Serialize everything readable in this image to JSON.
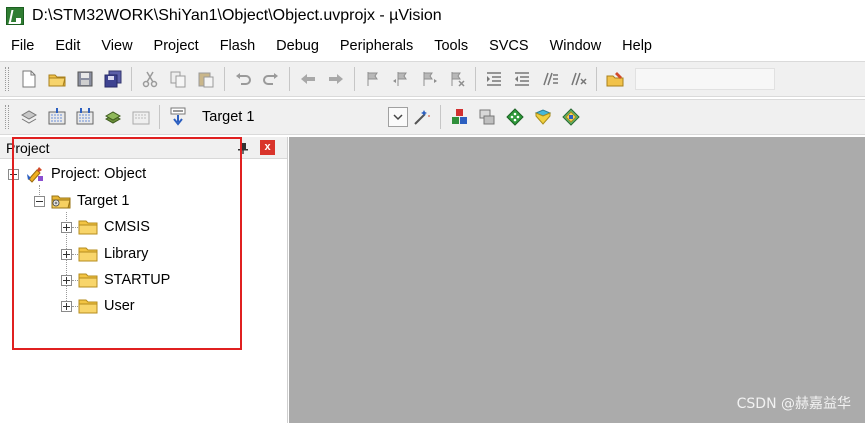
{
  "window": {
    "title": "D:\\STM32WORK\\ShiYan1\\Object\\Object.uvprojx - µVision",
    "app_icon": "uvision-icon"
  },
  "menu": {
    "items": [
      "File",
      "Edit",
      "View",
      "Project",
      "Flash",
      "Debug",
      "Peripherals",
      "Tools",
      "SVCS",
      "Window",
      "Help"
    ]
  },
  "toolbar_build": {
    "target_selected": "Target 1"
  },
  "project_panel": {
    "title": "Project",
    "close_label": "x",
    "tree": {
      "root": "Project: Object",
      "target": "Target 1",
      "groups": [
        "CMSIS",
        "Library",
        "STARTUP",
        "User"
      ]
    }
  },
  "colors": {
    "highlight_border": "#e02020",
    "editor_background": "#ababab",
    "folder": "#f5c542"
  },
  "watermark": "CSDN @赫嘉益华"
}
